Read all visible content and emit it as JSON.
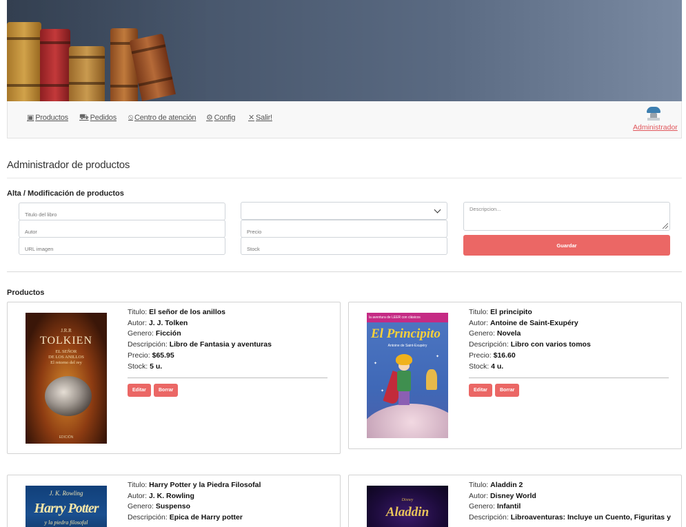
{
  "nav": {
    "items": [
      {
        "label": "Productos",
        "icon": "book-icon"
      },
      {
        "label": "Pedidos",
        "icon": "truck-icon"
      },
      {
        "label": "Centro de atención",
        "icon": "support-icon"
      },
      {
        "label": "Config",
        "icon": "gear-icon"
      },
      {
        "label": "Salir!",
        "icon": "close-icon"
      }
    ],
    "user_label": "Administrador"
  },
  "page": {
    "title": "Administrador de productos",
    "form_title": "Alta / Modificación de productos",
    "products_title": "Productos"
  },
  "form": {
    "titulo_placeholder": "Titulo del libro",
    "autor_placeholder": "Autor",
    "url_placeholder": "URL imagen",
    "genero_selected": "",
    "precio_placeholder": "Precio",
    "stock_placeholder": "Stock",
    "descripcion_placeholder": "Descripcion...",
    "save_label": "Guardar"
  },
  "labels": {
    "titulo": "Titulo:",
    "autor": "Autor:",
    "genero": "Genero:",
    "descripcion": "Descripción:",
    "precio": "Precio:",
    "stock": "Stock:",
    "edit": "Editar",
    "delete": "Borrar"
  },
  "products": [
    {
      "titulo": "El señor de los anillos",
      "autor": "J. J. Tolken",
      "genero": "Ficción",
      "descripcion": "Libro de Fantasia y aventuras",
      "precio": "$65.95",
      "stock": "5 u.",
      "cover": {
        "top": "J.R.R",
        "title": "TOLKIEN",
        "sub1": "EL SEÑOR",
        "sub2": "DE LOS ANILLOS",
        "sub3": "El retorno del rey",
        "footer": "EDICIÓN"
      }
    },
    {
      "titulo": "El principito",
      "autor": "Antoine de Saint-Exupéry",
      "genero": "Novela",
      "descripcion": "Libro con varios tomos",
      "precio": "$16.60",
      "stock": "4 u.",
      "cover": {
        "strip": "la aventura de LEER con clásicos",
        "title": "El Principito",
        "sub": "Antoine de Saint-Exupéry"
      }
    },
    {
      "titulo": "Harry Potter y la Piedra Filosofal",
      "autor": "J. K. Rowling",
      "genero": "Suspenso",
      "descripcion": "Epica de Harry potter",
      "cover": {
        "author": "J. K. Rowling",
        "title": "Harry Potter",
        "sub": "y la piedra filosofal"
      }
    },
    {
      "titulo": "Aladdin 2",
      "autor": "Disney World",
      "genero": "Infantil",
      "descripcion": "Libroaventuras: Incluye un Cuento, Figuritas y",
      "cover": {
        "brand": "Disney",
        "title": "Aladdin"
      }
    }
  ]
}
